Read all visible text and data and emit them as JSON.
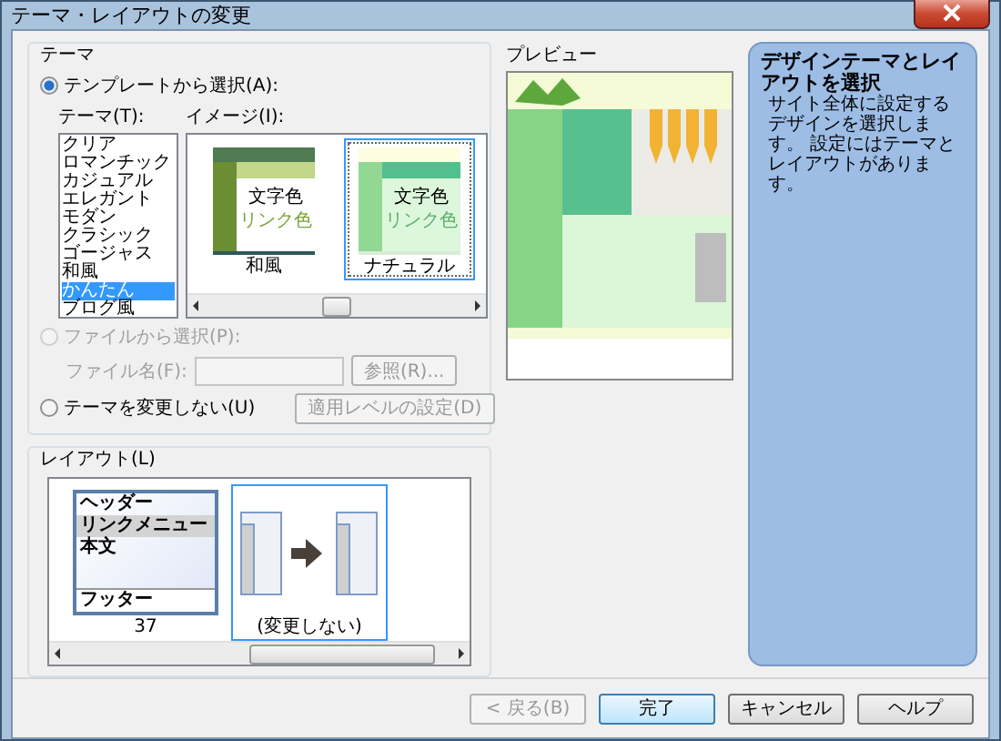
{
  "window": {
    "title": "テーマ・レイアウトの変更"
  },
  "theme": {
    "label": "テーマ",
    "template_option": {
      "label": "テンプレートから選択(A):",
      "selected": true,
      "disabled": false
    },
    "theme_list": {
      "label": "テーマ(T):",
      "items": [
        {
          "label": "クリア",
          "selected": false
        },
        {
          "label": "ロマンチック",
          "selected": false
        },
        {
          "label": "カジュアル",
          "selected": false
        },
        {
          "label": "エレガント",
          "selected": false
        },
        {
          "label": "モダン",
          "selected": false
        },
        {
          "label": "クラシック",
          "selected": false
        },
        {
          "label": "ゴージャス",
          "selected": false
        },
        {
          "label": "和風",
          "selected": false
        },
        {
          "label": "かんたん",
          "selected": true
        },
        {
          "label": "ブログ風",
          "selected": false
        }
      ]
    },
    "image_list": {
      "label": "イメージ(I):",
      "items": [
        {
          "kind": "wafu",
          "caption": "和風",
          "text_sample": "文字色",
          "link_sample": "リンク色",
          "selected": false
        },
        {
          "kind": "natural",
          "caption": "ナチュラル",
          "text_sample": "文字色",
          "link_sample": "リンク色",
          "selected": true
        }
      ]
    },
    "file_option": {
      "label": "ファイルから選択(P):",
      "selected": false,
      "disabled": true
    },
    "file_field": {
      "label": "ファイル名(F):",
      "disabled": true
    },
    "browse_button": {
      "label": "参照(R)...",
      "disabled": true
    },
    "keep_option": {
      "label": "テーマを変更しない(U)",
      "selected": false,
      "disabled": false
    },
    "apply_level_button": {
      "label": "適用レベルの設定(D)",
      "disabled": true
    }
  },
  "layout": {
    "label": "レイアウト(L)",
    "items": [
      {
        "kind": "frame",
        "regions": [
          "ヘッダー",
          "リンクメニュー",
          "本文",
          "フッター"
        ],
        "caption": "37",
        "selected": false
      },
      {
        "kind": "unchanged",
        "caption": "(変更しない)",
        "selected": true
      }
    ]
  },
  "preview": {
    "label": "プレビュー",
    "kind": "picture"
  },
  "info": {
    "title": "デザインテーマとレイアウトを選択",
    "body": "サイト全体に設定するデザインを選択します。 設定にはテーマとレイアウトがあります。"
  },
  "buttons": [
    {
      "label": "< 戻る(B)",
      "disabled": true,
      "default": false
    },
    {
      "label": "完了",
      "disabled": false,
      "default": true
    },
    {
      "label": "キャンセル",
      "disabled": false,
      "default": false
    },
    {
      "label": "ヘルプ",
      "disabled": false,
      "default": false
    }
  ]
}
